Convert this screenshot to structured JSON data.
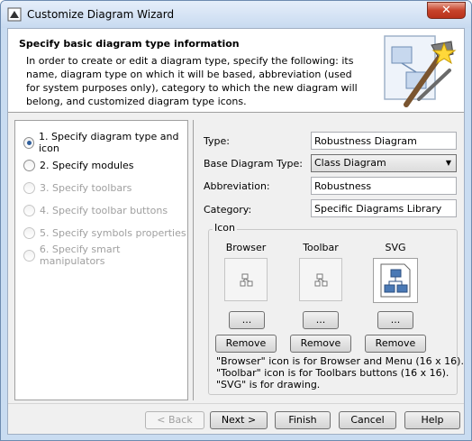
{
  "window": {
    "title": "Customize Diagram Wizard",
    "close_glyph": "✕"
  },
  "header": {
    "title": "Specify basic diagram type information",
    "description": "In order to create or edit a diagram type, specify the following: its name, diagram type on which it will be based, abbreviation (used for system purposes only), category to which the new diagram will belong, and customized diagram type icons."
  },
  "steps": [
    {
      "label": "1. Specify diagram type and icon",
      "selected": true,
      "enabled": true
    },
    {
      "label": "2. Specify modules",
      "selected": false,
      "enabled": true
    },
    {
      "label": "3. Specify toolbars",
      "selected": false,
      "enabled": false
    },
    {
      "label": "4. Specify toolbar buttons",
      "selected": false,
      "enabled": false
    },
    {
      "label": "5. Specify symbols properties",
      "selected": false,
      "enabled": false
    },
    {
      "label": "6. Specify smart manipulators",
      "selected": false,
      "enabled": false
    }
  ],
  "form": {
    "type_label": "Type:",
    "type_value": "Robustness Diagram",
    "base_label": "Base Diagram Type:",
    "base_value": "Class Diagram",
    "abbrev_label": "Abbreviation:",
    "abbrev_value": "Robustness",
    "category_label": "Category:",
    "category_value": "Specific Diagrams Library"
  },
  "icon_group": {
    "legend": "Icon",
    "browser_label": "Browser",
    "toolbar_label": "Toolbar",
    "svg_label": "SVG",
    "browse_label": "...",
    "remove_label": "Remove",
    "notes": [
      "\"Browser\" icon is for Browser and Menu (16 x 16).",
      "\"Toolbar\" icon is for Toolbars buttons (16 x 16).",
      "\"SVG\" is for drawing."
    ]
  },
  "footer": {
    "back": "< Back",
    "next": "Next >",
    "finish": "Finish",
    "cancel": "Cancel",
    "help": "Help"
  },
  "colors": {
    "title_bar": "#c8daf0",
    "close_button": "#c7432b",
    "selected_radio": "#2f5f9c",
    "disabled_text": "#a0a0a0"
  }
}
